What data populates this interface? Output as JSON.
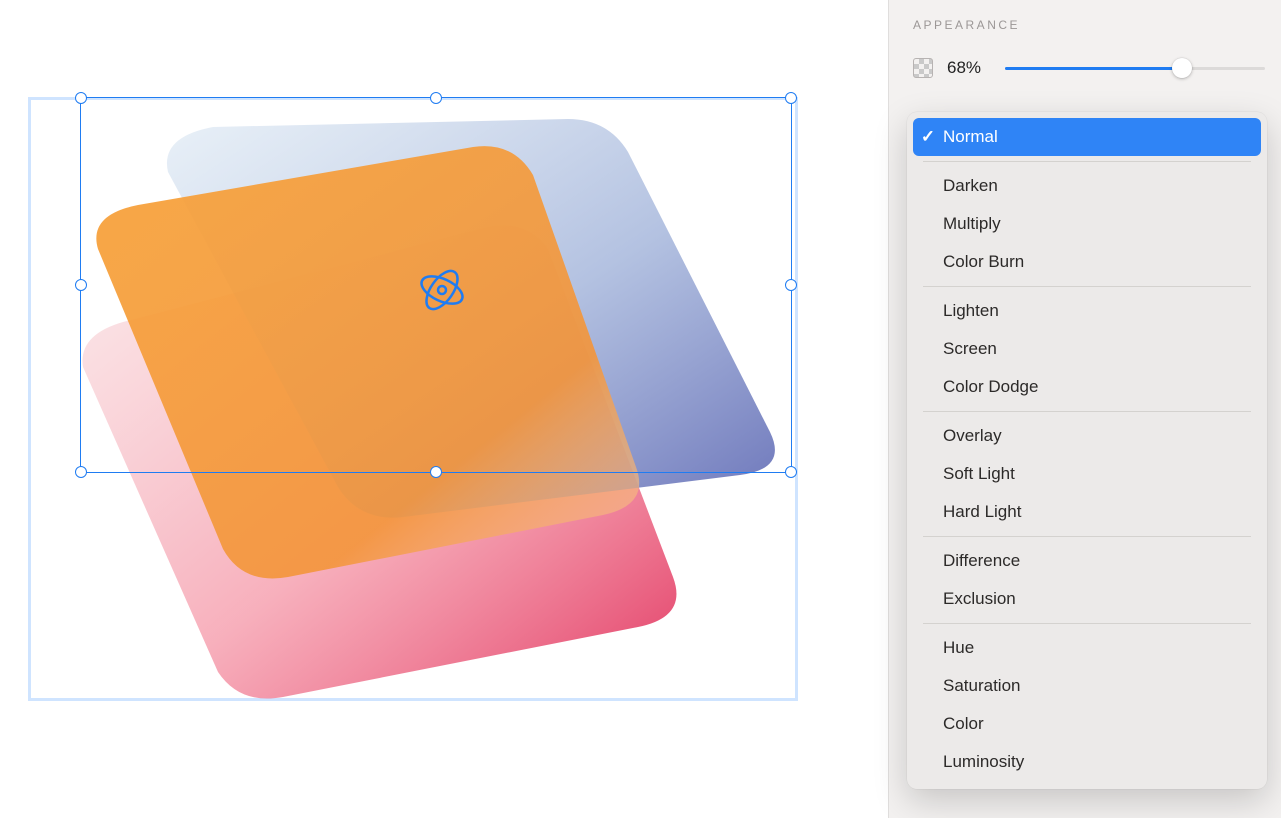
{
  "appearance": {
    "title": "APPEARANCE",
    "opacity_value": "68%",
    "opacity_percent": 68
  },
  "blend_modes": {
    "selected_index": 0,
    "groups": [
      [
        "Normal"
      ],
      [
        "Darken",
        "Multiply",
        "Color Burn"
      ],
      [
        "Lighten",
        "Screen",
        "Color Dodge"
      ],
      [
        "Overlay",
        "Soft Light",
        "Hard Light"
      ],
      [
        "Difference",
        "Exclusion"
      ],
      [
        "Hue",
        "Saturation",
        "Color",
        "Luminosity"
      ]
    ]
  },
  "colors": {
    "selection_blue": "#1f7cf2",
    "panel_bg": "#f3f1f0",
    "menu_bg": "#eceae9",
    "text": "#2c2a29"
  }
}
